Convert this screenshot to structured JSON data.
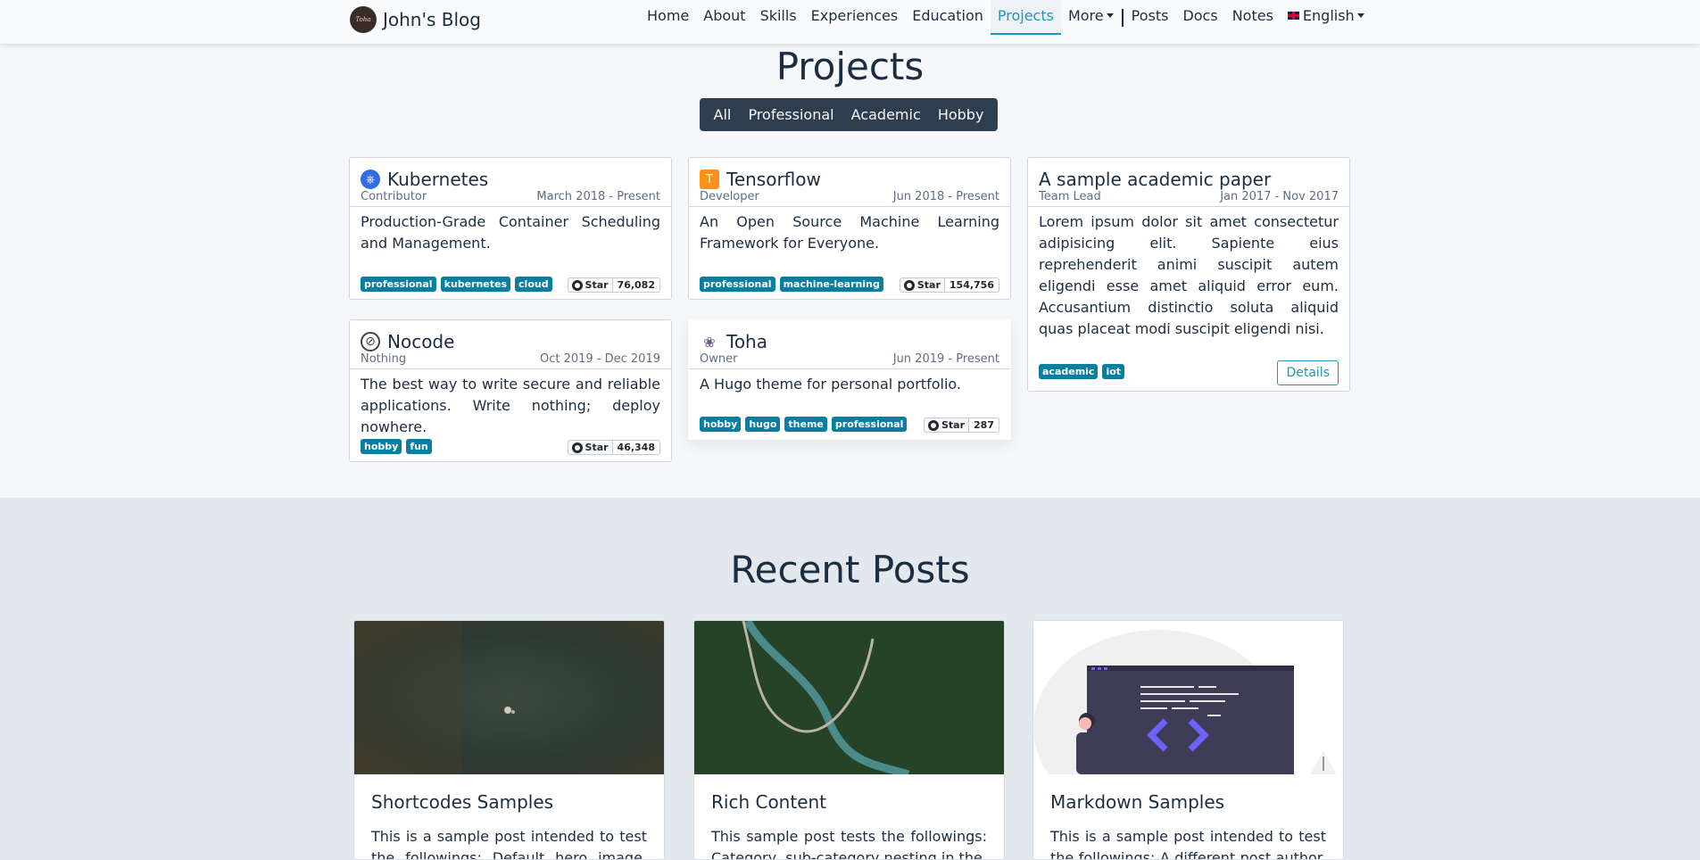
{
  "nav": {
    "brand": "John's Blog",
    "logo_text": "Toha",
    "items": [
      "Home",
      "About",
      "Skills",
      "Experiences",
      "Education",
      "Projects"
    ],
    "more": "More",
    "items2": [
      "Posts",
      "Docs",
      "Notes"
    ],
    "language": "English",
    "active": "Projects"
  },
  "projects": {
    "title": "Projects",
    "filters": [
      "All",
      "Professional",
      "Academic",
      "Hobby"
    ],
    "cards": [
      {
        "name": "Kubernetes",
        "role": "Contributor",
        "period": "March 2018 - Present",
        "description": "Production-Grade Container Scheduling and Management.",
        "tags": [
          "professional",
          "kubernetes",
          "cloud"
        ],
        "star_label": "Star",
        "stars": "76,082",
        "icon": "kubernetes-icon"
      },
      {
        "name": "Tensorflow",
        "role": "Developer",
        "period": "Jun 2018 - Present",
        "description": "An Open Source Machine Learning Framework for Everyone.",
        "tags": [
          "professional",
          "machine-learning"
        ],
        "star_label": "Star",
        "stars": "154,756",
        "icon": "tensorflow-icon"
      },
      {
        "name": "A sample academic paper",
        "role": "Team Lead",
        "period": "Jan 2017 - Nov 2017",
        "description": "Lorem ipsum dolor sit amet consectetur adipisicing elit. Sapiente eius reprehenderit animi suscipit autem eligendi esse amet aliquid error eum. Accusantium distinctio soluta aliquid quas placeat modi suscipit eligendi nisi.",
        "tags": [
          "academic",
          "iot"
        ],
        "details_label": "Details"
      },
      {
        "name": "Nocode",
        "role": "Nothing",
        "period": "Oct 2019 - Dec 2019",
        "description": "The best way to write secure and reliable applications. Write nothing; deploy nowhere.",
        "tags": [
          "hobby",
          "fun"
        ],
        "star_label": "Star",
        "stars": "46,348",
        "icon": "nocode-icon"
      },
      {
        "name": "Toha",
        "role": "Owner",
        "period": "Jun 2019 - Present",
        "description": "A Hugo theme for personal portfolio.",
        "tags": [
          "hobby",
          "hugo",
          "theme",
          "professional"
        ],
        "star_label": "Star",
        "stars": "287",
        "icon": "toha-icon"
      }
    ]
  },
  "posts": {
    "title": "Recent Posts",
    "items": [
      {
        "title": "Shortcodes Samples",
        "summary": "This is a sample post intended to test the followings: Default hero image. Different"
      },
      {
        "title": "Rich Content",
        "summary": "This sample post tests the followings: Category, sub-category nesting in the"
      },
      {
        "title": "Markdown Samples",
        "summary": "This is a sample post intended to test the followings: A different post author. Table"
      }
    ]
  }
}
